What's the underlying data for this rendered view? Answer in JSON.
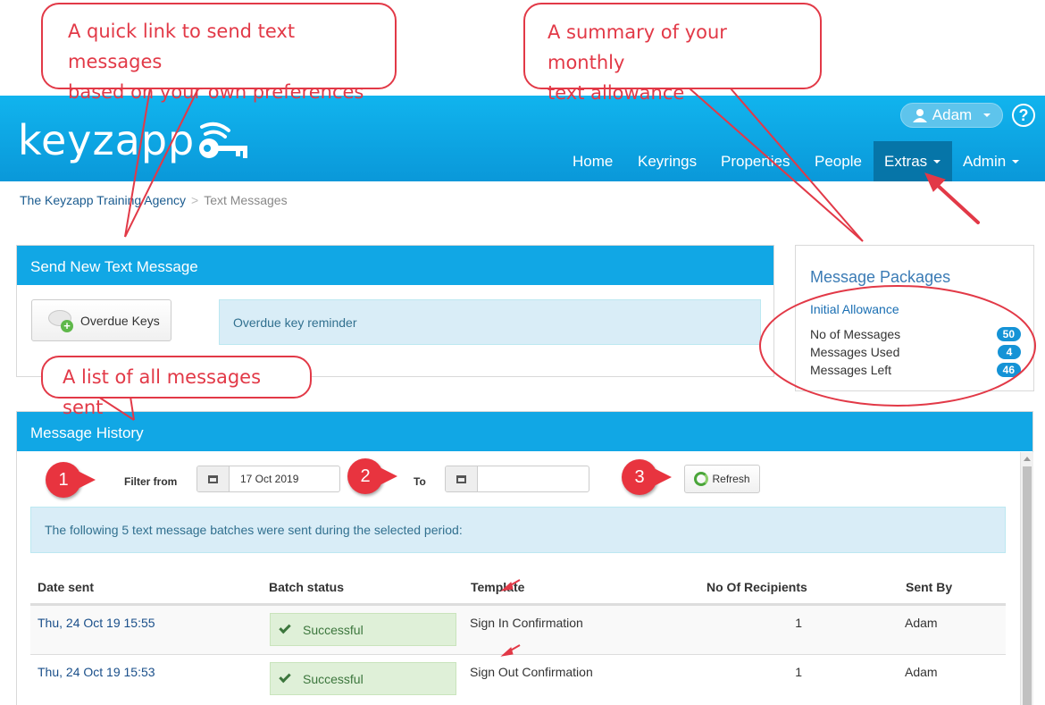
{
  "header": {
    "logo_text": "keyzapp",
    "user_name": "Adam",
    "help_label": "?",
    "nav": [
      {
        "label": "Home"
      },
      {
        "label": "Keyrings"
      },
      {
        "label": "Properties"
      },
      {
        "label": "People"
      },
      {
        "label": "Extras"
      },
      {
        "label": "Admin"
      }
    ]
  },
  "breadcrumb": {
    "agency": "The Keyzapp Training Agency",
    "separator": ">",
    "current": "Text Messages"
  },
  "send_panel": {
    "title": "Send New Text Message",
    "button_label": "Overdue Keys",
    "reminder_text": "Overdue key reminder"
  },
  "packages": {
    "title": "Message Packages",
    "subtitle": "Initial Allowance",
    "rows": [
      {
        "label": "No of Messages",
        "value": "50"
      },
      {
        "label": "Messages Used",
        "value": "4"
      },
      {
        "label": "Messages Left",
        "value": "46"
      }
    ]
  },
  "history": {
    "title": "Message History",
    "filter_from_label": "Filter from",
    "from_value": "17 Oct 2019",
    "to_label": "To",
    "to_value": "",
    "refresh_label": "Refresh",
    "info_text": "The following 5 text message batches were sent during the selected period:",
    "columns": [
      "Date sent",
      "Batch status",
      "Template",
      "No Of Recipients",
      "Sent By"
    ],
    "rows": [
      {
        "date": "Thu, 24 Oct 19 15:55",
        "status": "Successful",
        "template": "Sign In Confirmation",
        "recipients": "1",
        "sent_by": "Adam"
      },
      {
        "date": "Thu, 24 Oct 19 15:53",
        "status": "Successful",
        "template": "Sign Out Confirmation",
        "recipients": "1",
        "sent_by": "Adam"
      }
    ]
  },
  "annotations": {
    "quick_link": [
      "A quick link to send text messages",
      "based on your own preferences"
    ],
    "summary": [
      "A summary of your monthly",
      "text allowance"
    ],
    "list": "A list of all messages sent",
    "steps": [
      "1",
      "2",
      "3"
    ]
  },
  "colors": {
    "header_blue": "#11a7e5",
    "nav_active": "#0675a8",
    "annotation_red": "#e23947",
    "success_bg": "#dff0d8",
    "badge_blue": "#1593d6"
  }
}
